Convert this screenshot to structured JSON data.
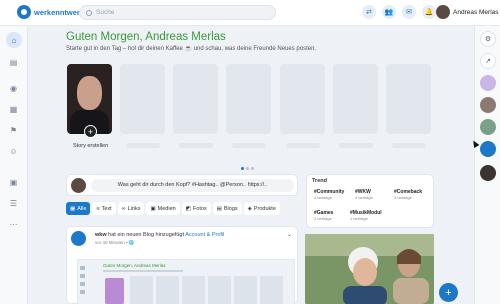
{
  "header": {
    "brand": "werkenntwen",
    "search_placeholder": "Suche",
    "user_name": "Andreas Merlas"
  },
  "main": {
    "greeting": "Guten Morgen, Andreas Merlas",
    "subtitle": "Starte gut in den Tag – hol dir deinen Kaffee ☕ und schau, was deine Freunde Neues posten.",
    "stories": {
      "create_label": "Story erstellen",
      "add_symbol": "+"
    },
    "composer": {
      "prompt": "Was geht dir durch den Kopf? #Hashtag.. @Person.. https://.."
    },
    "filter_tabs": [
      {
        "label": "Alle",
        "icon": "grid-icon",
        "active": true
      },
      {
        "label": "Text",
        "icon": "text-icon",
        "active": false
      },
      {
        "label": "Links",
        "icon": "link-icon",
        "active": false
      },
      {
        "label": "Medien",
        "icon": "media-icon",
        "active": false
      },
      {
        "label": "Fotos",
        "icon": "photo-icon",
        "active": false
      },
      {
        "label": "Blogs",
        "icon": "blog-icon",
        "active": false
      },
      {
        "label": "Produkte",
        "icon": "product-icon",
        "active": false
      }
    ],
    "feed_post": {
      "author": "wkw",
      "action": "hat ein neuen Blog hinzugefügt",
      "link": "Account & Profil",
      "time": "vor 40 Minuten • 🌐",
      "preview_greeting": "Guten Morgen, Andreas Merlas"
    }
  },
  "trend": {
    "title": "Trend",
    "items": [
      {
        "tag": "#Community",
        "count": "4 beiträge"
      },
      {
        "tag": "#WKW",
        "count": "4 beiträge"
      },
      {
        "tag": "#Comeback",
        "count": "3 beiträge"
      },
      {
        "tag": "#Games",
        "count": "2 beiträge"
      },
      {
        "tag": "#MusikModul",
        "count": "1 beiträge"
      }
    ]
  },
  "fab": {
    "label": "+"
  },
  "colors": {
    "brand": "#1d78c8",
    "greeting": "#3a9a3a",
    "background": "#eef1f6"
  }
}
